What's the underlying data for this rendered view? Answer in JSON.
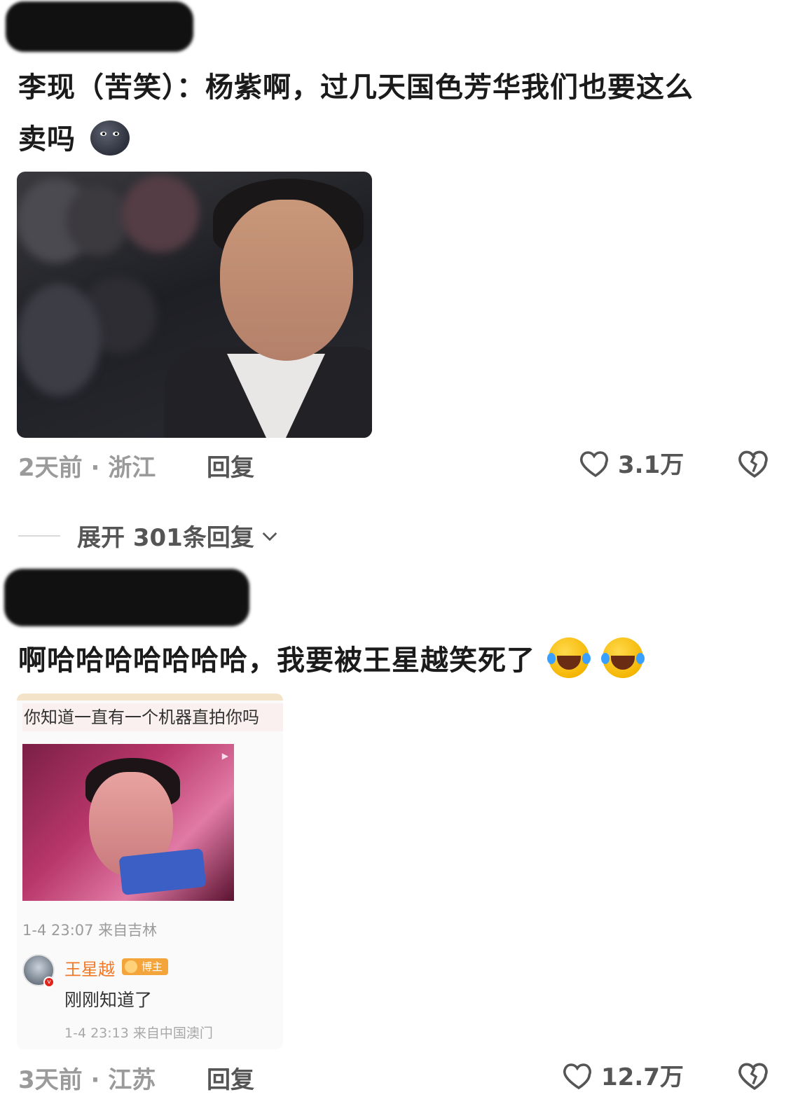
{
  "comment1": {
    "text": "李现（苦笑）：杨紫啊，过几天国色芳华我们也要这么",
    "text_line2": "卖吗",
    "emoji": "new-moon-face",
    "meta": "2天前 · 浙江",
    "reply_label": "回复",
    "likes": "3.1万"
  },
  "expand": {
    "label": "展开 301条回复"
  },
  "comment2": {
    "text": "啊哈哈哈哈哈哈哈，我要被王星越笑死了",
    "emojis": [
      "rolling-laughing-face",
      "rolling-laughing-face"
    ],
    "meta": "3天前 · 江苏",
    "reply_label": "回复",
    "likes": "12.7万"
  },
  "card": {
    "quote": "你知道一直有一个机器直拍你吗",
    "date": "1-4 23:07  来自吉林",
    "author": "王星越",
    "badge": "博主",
    "reply": "刚刚知道了",
    "reply_date": "1-4 23:13  来自中国澳门"
  },
  "colors": {
    "accent_orange": "#f07a2a",
    "meta_gray": "#9a9a9a",
    "text_dark": "#1b1b1b"
  }
}
